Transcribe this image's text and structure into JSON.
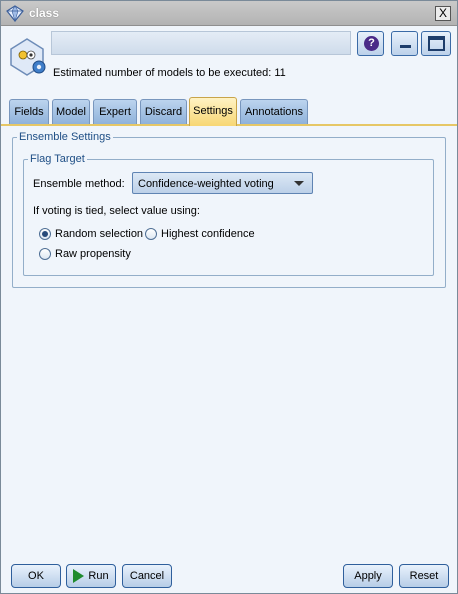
{
  "window": {
    "title": "class",
    "close_label": "X"
  },
  "header": {
    "node_name_value": "",
    "help_label": "?",
    "estimate_text": "Estimated number of models to be executed: 11"
  },
  "tabs": [
    {
      "label": "Fields",
      "active": false
    },
    {
      "label": "Model",
      "active": false
    },
    {
      "label": "Expert",
      "active": false
    },
    {
      "label": "Discard",
      "active": false
    },
    {
      "label": "Settings",
      "active": true
    },
    {
      "label": "Annotations",
      "active": false
    }
  ],
  "ensemble": {
    "group_label": "Ensemble Settings",
    "flag_group_label": "Flag Target",
    "method_label": "Ensemble method:",
    "method_value": "Confidence-weighted voting",
    "tied_label": "If voting is tied, select value using:",
    "options": [
      {
        "label": "Random selection",
        "checked": true
      },
      {
        "label": "Highest confidence",
        "checked": false
      },
      {
        "label": "Raw propensity",
        "checked": false
      }
    ]
  },
  "buttons": {
    "ok": "OK",
    "run": "Run",
    "cancel": "Cancel",
    "apply": "Apply",
    "reset": "Reset"
  },
  "icons": {
    "title": "diamond-node-icon",
    "node": "ensemble-node-icon",
    "run": "play-icon"
  },
  "colors": {
    "active_tab": "#f7d774",
    "tab": "#8fb2da",
    "button_border": "#2f5f9c",
    "run_play": "#1f8b2e"
  }
}
